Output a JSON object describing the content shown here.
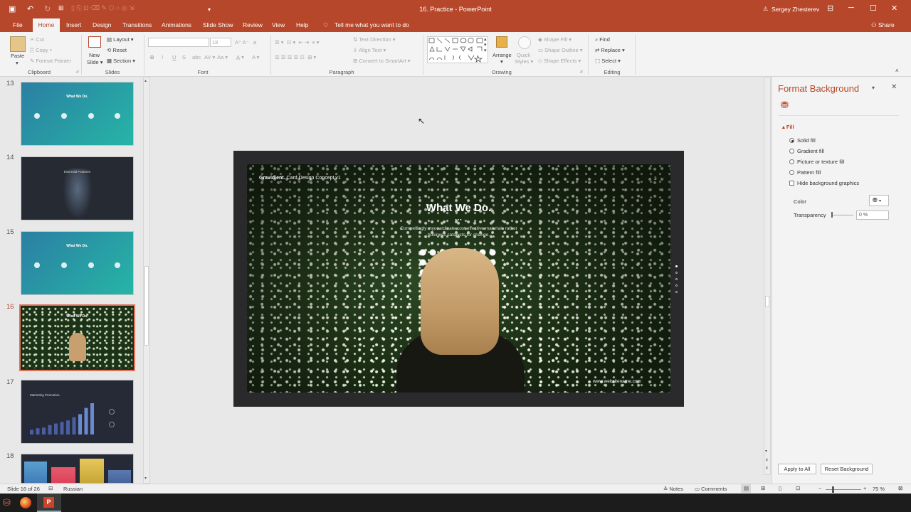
{
  "titlebar": {
    "title": "16. Practice  -  PowerPoint",
    "user": "Sergey Zhesterev",
    "minimize_icon": "─",
    "maximize_icon": "☐",
    "close_icon": "✕",
    "ribbon_display_icon": "⊟"
  },
  "tabs": [
    {
      "label": "File"
    },
    {
      "label": "Home"
    },
    {
      "label": "Insert"
    },
    {
      "label": "Design"
    },
    {
      "label": "Transitions"
    },
    {
      "label": "Animations"
    },
    {
      "label": "Slide Show"
    },
    {
      "label": "Review"
    },
    {
      "label": "View"
    },
    {
      "label": "Help"
    }
  ],
  "tell_me": "Tell me what you want to do",
  "share": "Share",
  "ribbon": {
    "clipboard": {
      "label": "Clipboard",
      "paste": "Paste",
      "cut": "Cut",
      "copy": "Copy",
      "format_painter": "Format Painter"
    },
    "slides": {
      "label": "Slides",
      "new_slide": "New",
      "new_slide2": "Slide",
      "layout": "Layout",
      "reset": "Reset",
      "section": "Section"
    },
    "font": {
      "label": "Font",
      "size": "18"
    },
    "paragraph": {
      "label": "Paragraph",
      "text_direction": "Text Direction",
      "align_text": "Align Text",
      "convert_smartart": "Convert to SmartArt"
    },
    "drawing": {
      "label": "Drawing",
      "arrange": "Arrange",
      "quick_styles": "Quick",
      "quick_styles2": "Styles",
      "shape_fill": "Shape Fill",
      "shape_outline": "Shape Outline",
      "shape_effects": "Shape Effects"
    },
    "editing": {
      "label": "Editing",
      "find": "Find",
      "replace": "Replace",
      "select": "Select"
    }
  },
  "slides": [
    {
      "number": "13",
      "title": "What We Do.",
      "style": "teal"
    },
    {
      "number": "14",
      "title": "Essential Features",
      "style": "dark-portrait"
    },
    {
      "number": "15",
      "title": "What We Do.",
      "style": "teal"
    },
    {
      "number": "16",
      "title": "What We Do.",
      "style": "photo",
      "selected": true
    },
    {
      "number": "17",
      "title": "Marketing Promotion.",
      "style": "chart"
    },
    {
      "number": "18",
      "title": "",
      "style": "color-cards"
    }
  ],
  "current_slide": {
    "brand": "Gravidient.",
    "brand_sub": "Card Design Concept v1",
    "page_num": "3",
    "heading": "What We Do.",
    "dots": "●●●",
    "body_line1": "Compellingly myocardinate cost effective materials rather",
    "body_line2": "business catalysts for change.",
    "url": "www.websitename.com"
  },
  "format_pane": {
    "title": "Format Background",
    "section": "Fill",
    "options": [
      {
        "label": "Solid fill",
        "selected": true
      },
      {
        "label": "Gradient fill",
        "selected": false
      },
      {
        "label": "Picture or texture fill",
        "selected": false
      },
      {
        "label": "Pattern fill",
        "selected": false
      }
    ],
    "hide_bg": "Hide background graphics",
    "color_label": "Color",
    "transparency_label": "Transparency",
    "transparency_value": "0 %",
    "apply_all": "Apply to All",
    "reset_bg": "Reset Background"
  },
  "statusbar": {
    "slide_info": "Slide 16 of 26",
    "language": "Russian",
    "notes": "Notes",
    "comments": "Comments",
    "zoom": "75 %"
  },
  "thumb17_bars": [
    0.15,
    0.2,
    0.22,
    0.3,
    0.35,
    0.4,
    0.45,
    0.55,
    0.65,
    0.85,
    1.0
  ],
  "colors": {
    "accent": "#b7472a",
    "teal_start": "#2b7fa3",
    "teal_end": "#26b5a6"
  }
}
